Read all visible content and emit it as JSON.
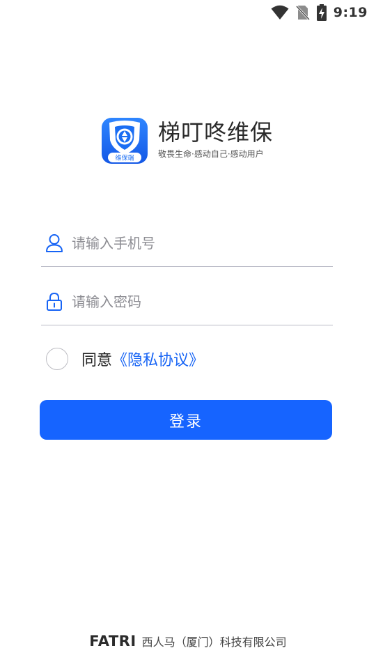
{
  "status_bar": {
    "time": "9:19",
    "icons": [
      "wifi-icon",
      "no-sim-icon",
      "battery-charging-icon"
    ]
  },
  "brand": {
    "logo_badge": "维保端",
    "title": "梯叮咚维保",
    "slogan": "敬畏生命·感动自己·感动用户"
  },
  "form": {
    "phone": {
      "placeholder": "请输入手机号",
      "value": "",
      "icon": "user-icon"
    },
    "password": {
      "placeholder": "请输入密码",
      "value": "",
      "icon": "lock-icon"
    },
    "agreement": {
      "prefix": "同意",
      "link": "《隐私协议》",
      "checked": false
    },
    "login_label": "登录"
  },
  "footer": {
    "company_logo": "FATRI",
    "company_name": "西人马（厦门）科技有限公司"
  },
  "colors": {
    "primary": "#1664ff",
    "link": "#1764f5",
    "logo_blue": "#1b6ef3"
  }
}
